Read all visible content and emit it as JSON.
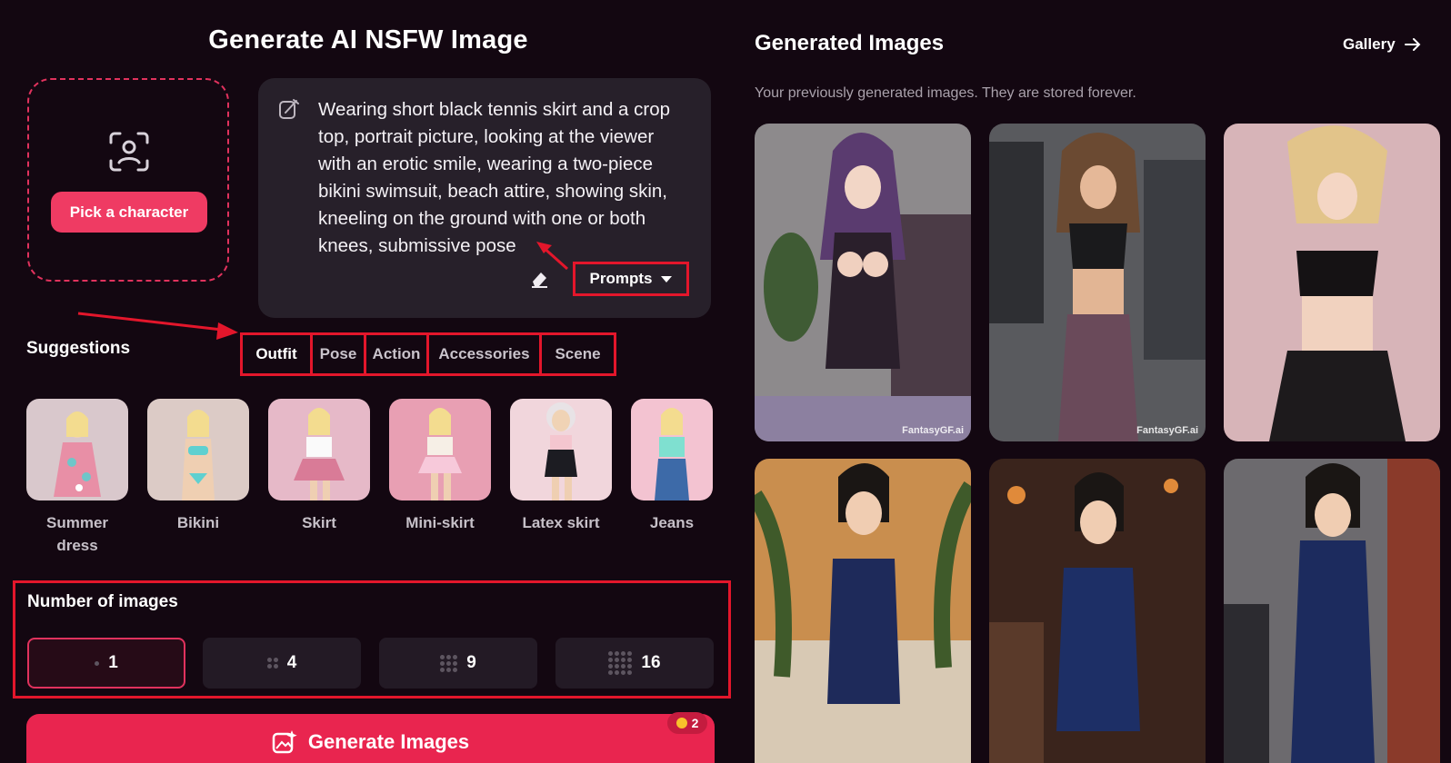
{
  "page_title": "Generate AI NSFW Image",
  "character": {
    "pick_label": "Pick a character",
    "icon": "face-scan-icon"
  },
  "prompt": {
    "text": "Wearing short black tennis skirt and a crop top, portrait picture, looking at the viewer with an erotic smile, wearing a two-piece bikini swimsuit, beach attire, showing skin, kneeling on the ground with one or both knees, submissive pose",
    "prompts_label": "Prompts"
  },
  "suggestions": {
    "label": "Suggestions",
    "tabs": [
      "Outfit",
      "Pose",
      "Action",
      "Accessories",
      "Scene"
    ],
    "active_tab": "Outfit",
    "items": [
      {
        "label": "Summer dress",
        "color": "#e88fa6"
      },
      {
        "label": "Bikini",
        "color": "#5fd0d0"
      },
      {
        "label": "Skirt",
        "color": "#d97b97"
      },
      {
        "label": "Mini-skirt",
        "color": "#f2b6cc"
      },
      {
        "label": "Latex skirt",
        "color": "#1c1c22"
      },
      {
        "label": "Jeans",
        "color": "#3d6aa8"
      }
    ]
  },
  "num_images": {
    "label": "Number of images",
    "options": [
      "1",
      "4",
      "9",
      "16"
    ],
    "selected": "1"
  },
  "generate": {
    "label": "Generate Images",
    "credits": "2"
  },
  "generated": {
    "title": "Generated Images",
    "gallery_label": "Gallery",
    "subtitle": "Your previously generated images. They are stored forever.",
    "watermark": "FantasyGF.ai"
  },
  "colors": {
    "accent": "#e9254f",
    "annotation": "#e3162b",
    "background": "#130711",
    "card": "#27202a"
  }
}
